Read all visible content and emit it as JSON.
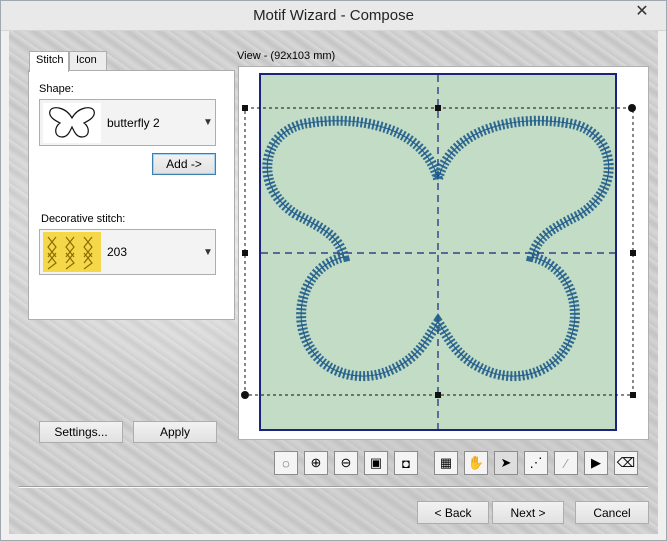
{
  "window": {
    "title": "Motif Wizard - Compose",
    "close_glyph": "✕"
  },
  "tabs": [
    {
      "label": "Stitch"
    },
    {
      "label": "Icon"
    }
  ],
  "stitch_panel": {
    "shape_label": "Shape:",
    "shape_value": "butterfly 2",
    "add_button": "Add ->",
    "decorative_label": "Decorative stitch:",
    "decorative_value": "203"
  },
  "lower_left": {
    "settings_button": "Settings...",
    "apply_button": "Apply"
  },
  "view": {
    "label": "View - (92x103 mm)",
    "hoop_color": "#c2dcc6",
    "stitch_color": "#1f5b8a",
    "frame_color": "#1a237e"
  },
  "toolbar": {
    "tools": [
      {
        "name": "hoop-icon",
        "glyph": "◌"
      },
      {
        "name": "zoom-in-icon",
        "glyph": "⊕"
      },
      {
        "name": "zoom-out-icon",
        "glyph": "⊖"
      },
      {
        "name": "zoom-fit-icon",
        "glyph": "▣"
      },
      {
        "name": "zoom-selection-icon",
        "glyph": "◘"
      },
      {
        "name": "background-image-icon",
        "glyph": "▦"
      },
      {
        "name": "hand-pan-icon",
        "glyph": "✋"
      },
      {
        "name": "select-arrow-icon",
        "glyph": "➤"
      },
      {
        "name": "reshape-nodes-icon",
        "glyph": "⋰"
      },
      {
        "name": "magic-wand-icon",
        "glyph": "⁄"
      },
      {
        "name": "pointer-icon",
        "glyph": "▶"
      },
      {
        "name": "eraser-icon",
        "glyph": "⌫"
      }
    ]
  },
  "footer": {
    "back_button": "< Back",
    "next_button": "Next >",
    "cancel_button": "Cancel"
  }
}
